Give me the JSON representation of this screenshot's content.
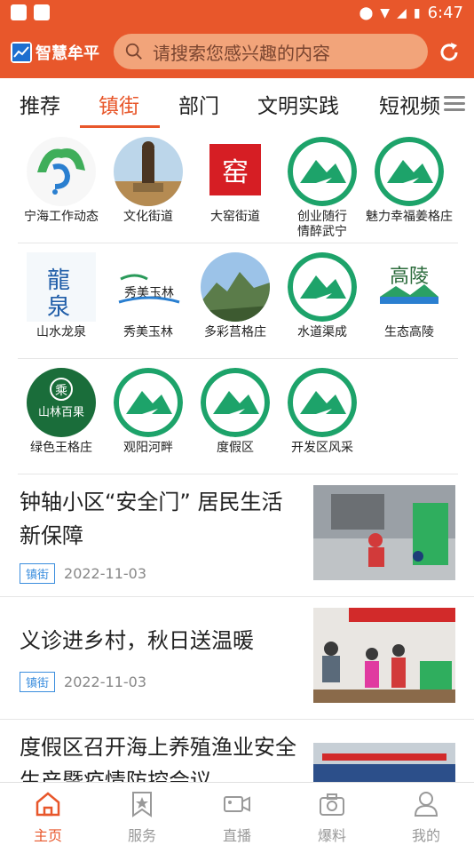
{
  "status": {
    "time": "6:47"
  },
  "header": {
    "logo": "智慧牟平",
    "search_placeholder": "请搜索您感兴趣的内容"
  },
  "tabs": [
    "推荐",
    "镇街",
    "部门",
    "文明实践",
    "短视频"
  ],
  "grid": [
    [
      "宁海工作动态",
      "文化街道",
      "大窑街道",
      "创业随行\n情醉武宁",
      "魅力幸福姜格庄"
    ],
    [
      "山水龙泉",
      "秀美玉林",
      "多彩莒格庄",
      "水道渠成",
      "生态高陵"
    ],
    [
      "绿色王格庄",
      "观阳河畔",
      "度假区",
      "开发区风采"
    ]
  ],
  "news": [
    {
      "title": "钟轴小区“安全门” 居民生活新保障",
      "tag": "镇街",
      "date": "2022-11-03"
    },
    {
      "title": "义诊进乡村，秋日送温暖",
      "tag": "镇街",
      "date": "2022-11-03"
    },
    {
      "title": "度假区召开海上养殖渔业安全生产暨疫情防控会议",
      "tag": "",
      "date": ""
    }
  ],
  "nav": [
    "主页",
    "服务",
    "直播",
    "爆料",
    "我的"
  ],
  "colors": {
    "accent": "#e8572b",
    "badge": "#3b8ede"
  }
}
